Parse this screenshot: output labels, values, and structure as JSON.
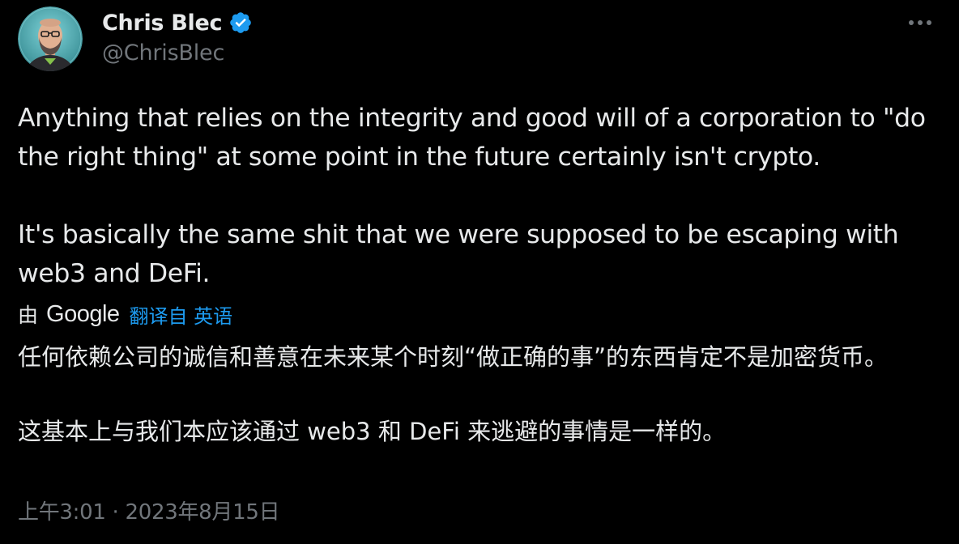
{
  "author": {
    "display_name": "Chris Blec",
    "handle": "@ChrisBlec",
    "verified_icon": "verified-badge-icon",
    "avatar_icon": "avatar"
  },
  "menu": {
    "more_icon": "more-icon"
  },
  "tweet": {
    "paragraph1": "Anything that relies on the integrity and good will of a corporation to \"do the right thing\" at some point in the future certainly isn't crypto.",
    "paragraph2": "It's basically the same shit that we were supposed to be escaping with web3 and DeFi."
  },
  "translation": {
    "by_label": "由",
    "provider": "Google",
    "link_text": "翻译自 英语",
    "paragraph1": "任何依赖公司的诚信和善意在未来某个时刻“做正确的事”的东西肯定不是加密货币。",
    "paragraph2": "这基本上与我们本应该通过 web3 和 DeFi 来逃避的事情是一样的。"
  },
  "meta": {
    "timestamp": "上午3:01 · 2023年8月15日"
  },
  "colors": {
    "background": "#000000",
    "text_primary": "#e7e9ea",
    "text_secondary": "#71767b",
    "link": "#1d9bf0",
    "verified": "#1d9bf0"
  }
}
